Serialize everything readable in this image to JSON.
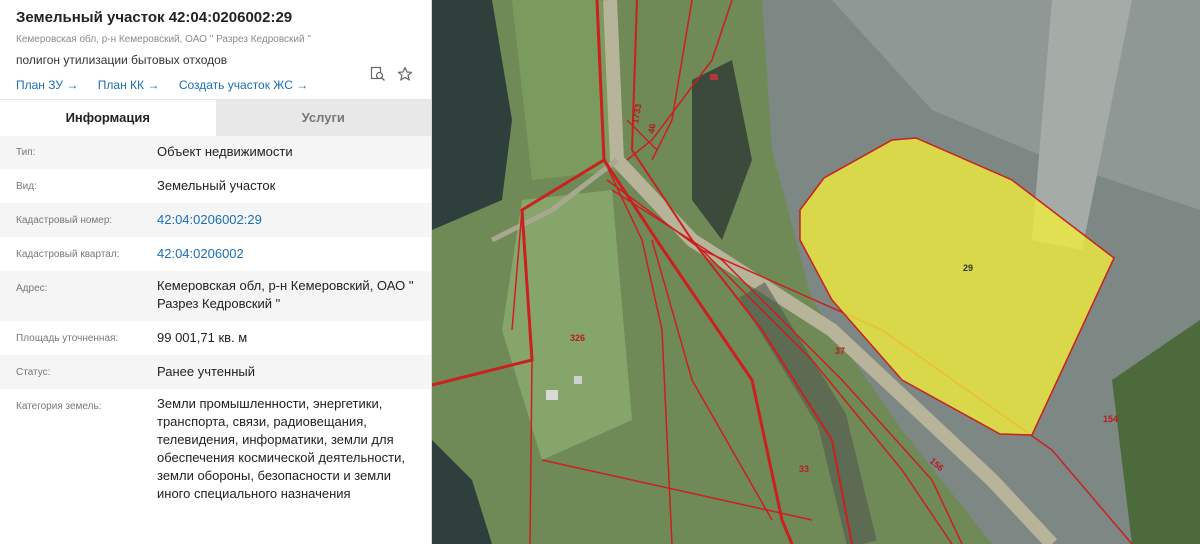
{
  "parcel": {
    "title": "Земельный участок 42:04:0206002:29",
    "subtitle": "Кемеровская обл, р-н Кемеровский, ОАО \" Разрез Кедровский \"",
    "usage": "полигон утилизации бытовых отходов",
    "links": [
      {
        "label": "План ЗУ →"
      },
      {
        "label": "План КК →"
      },
      {
        "label": "Создать участок ЖС →"
      }
    ]
  },
  "icons": {
    "search": "search-doc-icon",
    "favorite": "star-icon"
  },
  "tabs": [
    {
      "label": "Информация",
      "active": true
    },
    {
      "label": "Услуги",
      "active": false
    }
  ],
  "info": [
    {
      "label": "Тип:",
      "value": "Объект недвижимости"
    },
    {
      "label": "Вид:",
      "value": "Земельный участок"
    },
    {
      "label": "Кадастровый номер:",
      "value": "42:04:0206002:29"
    },
    {
      "label": "Кадастровый квартал:",
      "value": "42:04:0206002"
    },
    {
      "label": "Адрес:",
      "value": "Кемеровская обл, р-н Кемеровский, ОАО \" Разрез Кедровский \""
    },
    {
      "label": "Площадь уточненная:",
      "value": "99 001,71 кв. м"
    },
    {
      "label": "Статус:",
      "value": "Ранее учтенный"
    },
    {
      "label": "Категория земель:",
      "value": "Земли промышленности, энергетики, транспорта, связи, радиовещания, телевидения, информатики, земли для обеспечения космической деятельности, земли обороны, безопасности и земли иного специального назначения"
    }
  ],
  "map": {
    "labels": {
      "selected": "29",
      "p1733": "1733",
      "p46": "46",
      "p326": "326",
      "p37": "37",
      "p33": "33",
      "p156": "156",
      "p154": "154"
    },
    "colors": {
      "boundary": "#cc1f1f",
      "selected_fill": "#f2ee3a",
      "selected_stroke": "#cc1f1f"
    }
  }
}
